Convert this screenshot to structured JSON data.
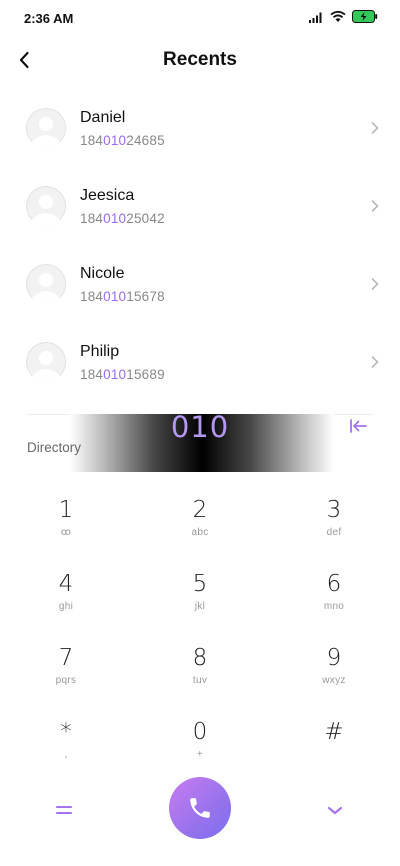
{
  "status_bar": {
    "time": "2:36 AM",
    "icons": [
      "signal-icon",
      "wifi-icon",
      "battery-charging-icon"
    ],
    "battery_color": "#34c759"
  },
  "header": {
    "title": "Recents",
    "back_icon": "chevron-left-icon"
  },
  "recents": [
    {
      "name": "Daniel",
      "number_prefix": "184",
      "number_match": "010",
      "number_suffix": "24685"
    },
    {
      "name": "Jeesica",
      "number_prefix": "184",
      "number_match": "010",
      "number_suffix": "25042"
    },
    {
      "name": "Nicole",
      "number_prefix": "184",
      "number_match": "010",
      "number_suffix": "15678"
    },
    {
      "name": "Philip",
      "number_prefix": "184",
      "number_match": "010",
      "number_suffix": "15689"
    }
  ],
  "dialer": {
    "directory_label": "Directory",
    "typed_number": "010",
    "delete_icon": "backspace-icon"
  },
  "keypad": [
    {
      "digit": "1",
      "letters": "ꝏ"
    },
    {
      "digit": "2",
      "letters": "abc"
    },
    {
      "digit": "3",
      "letters": "def"
    },
    {
      "digit": "4",
      "letters": "ghi"
    },
    {
      "digit": "5",
      "letters": "jkl"
    },
    {
      "digit": "6",
      "letters": "mno"
    },
    {
      "digit": "7",
      "letters": "pqrs"
    },
    {
      "digit": "8",
      "letters": "tuv"
    },
    {
      "digit": "9",
      "letters": "wxyz"
    },
    {
      "digit": "*",
      "letters": ","
    },
    {
      "digit": "0",
      "letters": "+"
    },
    {
      "digit": "#",
      "letters": ""
    }
  ],
  "bottom_bar": {
    "menu_icon": "menu-icon",
    "call_icon": "phone-icon",
    "collapse_icon": "chevron-down-icon"
  },
  "colors": {
    "accent": "#9a6ae8",
    "typed_number": "#b497f0"
  }
}
